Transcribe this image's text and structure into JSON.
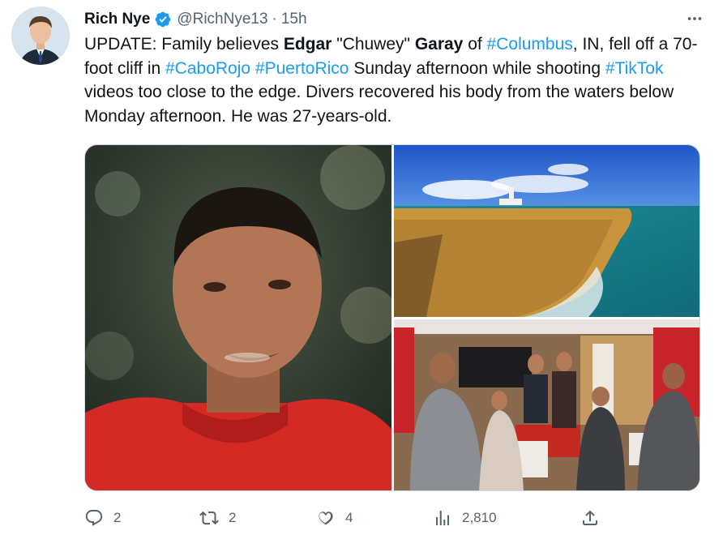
{
  "author": {
    "name": "Rich Nye",
    "handle": "@RichNye13",
    "separator": "·",
    "time": "15h"
  },
  "tweet": {
    "t1": "UPDATE: Family believes ",
    "b1": "Edgar",
    "t2": " \"Chuwey\" ",
    "b2": "Garay",
    "t3": " of ",
    "h1": "#Columbus",
    "t4": ", IN, fell off a 70-foot cliff in ",
    "h2": "#CaboRojo",
    "t5": " ",
    "h3": "#PuertoRico",
    "t6": " Sunday afternoon while shooting ",
    "h4": "#TikTok",
    "t7": " videos too close to the edge. Divers recovered his body from the waters below Monday afternoon. He was 27-years-old."
  },
  "actions": {
    "replies": "2",
    "reposts": "2",
    "likes": "4",
    "views": "2,810"
  },
  "colors": {
    "link": "#1d9bf0",
    "muted": "#536471",
    "verified": "#1d9bf0"
  },
  "icons": [
    "verified-badge-icon",
    "more-icon",
    "reply-icon",
    "repost-icon",
    "like-icon",
    "views-icon",
    "share-icon"
  ]
}
